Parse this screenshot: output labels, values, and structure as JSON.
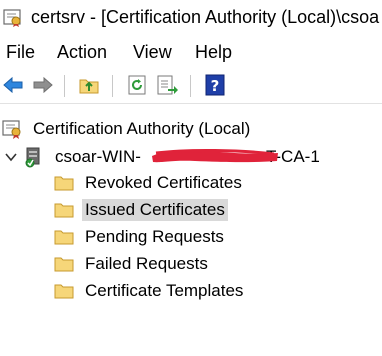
{
  "window": {
    "title": "certsrv - [Certification Authority (Local)\\csoa"
  },
  "menu": {
    "items": [
      "File",
      "Action",
      "View",
      "Help"
    ]
  },
  "toolbar": {
    "buttons": [
      "back-arrow-icon",
      "forward-arrow-icon",
      "up-folder-icon",
      "refresh-icon",
      "export-list-icon",
      "help-icon"
    ]
  },
  "tree": {
    "root_label": "Certification Authority (Local)",
    "ca_prefix": "csoar-WIN-",
    "ca_suffix": "T-CA-1",
    "children": [
      "Revoked Certificates",
      "Issued Certificates",
      "Pending Requests",
      "Failed Requests",
      "Certificate Templates"
    ],
    "selected_index": 1
  },
  "colors": {
    "folder_fill": "#f6d679",
    "folder_stroke": "#c79a2e",
    "selection": "#d9d9d9",
    "redaction": "#e0233a"
  }
}
